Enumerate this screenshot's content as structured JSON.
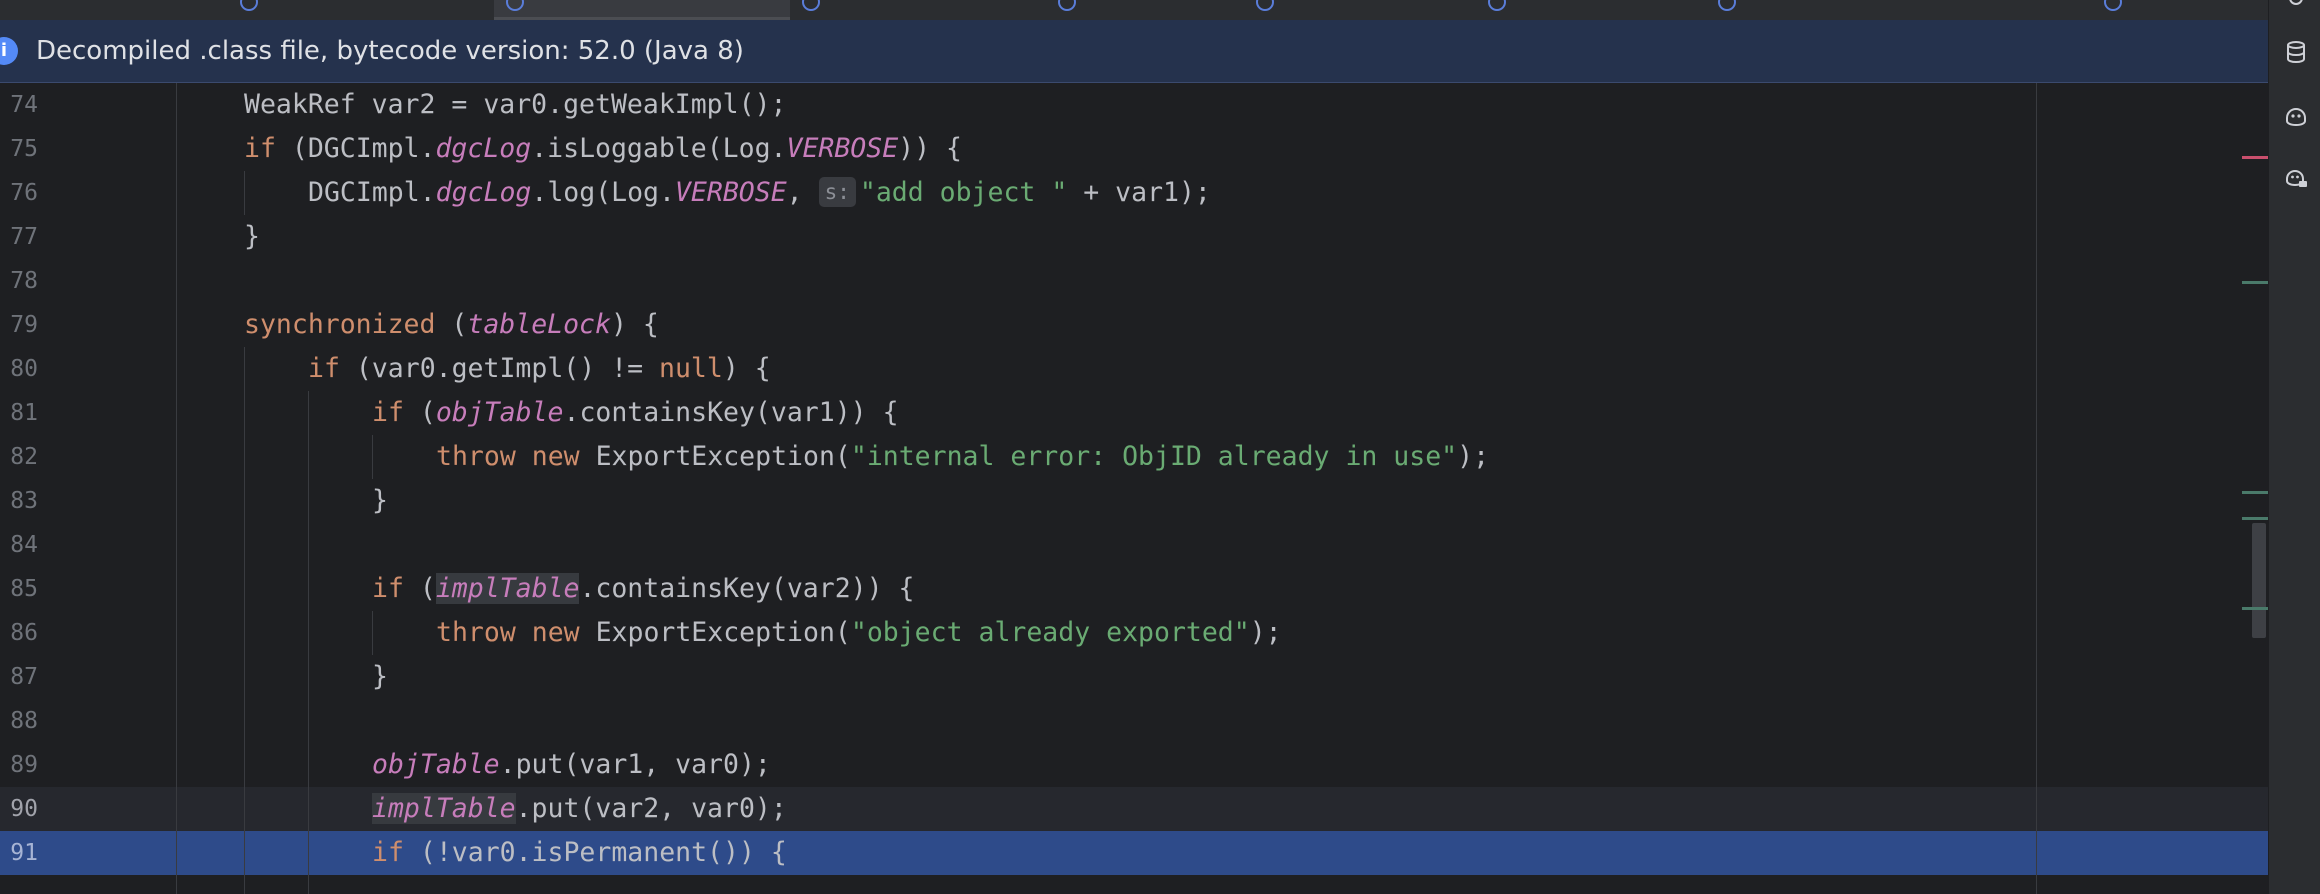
{
  "banner": {
    "icon": "info-icon",
    "text": "Decompiled .class file, bytecode version: 52.0 (Java 8)"
  },
  "tabs": [
    {
      "name": "tab-1",
      "active": false
    },
    {
      "name": "tab-2",
      "active": false
    },
    {
      "name": "tab-3",
      "active": true
    },
    {
      "name": "tab-4",
      "active": false
    },
    {
      "name": "tab-5",
      "active": false
    },
    {
      "name": "tab-6",
      "active": false
    },
    {
      "name": "tab-7",
      "active": false
    },
    {
      "name": "tab-8",
      "active": false
    },
    {
      "name": "tab-9",
      "active": false
    }
  ],
  "editor": {
    "caret_line": "90",
    "selected_line": "91",
    "lines": [
      {
        "num": "74",
        "t1": "WeakRef var2 = var0.getWeakImpl();"
      },
      {
        "num": "75",
        "kw1": "if",
        "t1": " (DGCImpl.",
        "f1": "dgcLog",
        "t2": ".isLoggable(Log.",
        "f2": "VERBOSE",
        "t3": ")) {"
      },
      {
        "num": "76",
        "t1": "DGCImpl.",
        "f1": "dgcLog",
        "t2": ".log(Log.",
        "f2": "VERBOSE",
        "t3": ", ",
        "hint": "s:",
        "s1": "\"add object \"",
        "t4": " + var1);"
      },
      {
        "num": "77",
        "t1": "}"
      },
      {
        "num": "78"
      },
      {
        "num": "79",
        "kw1": "synchronized",
        "t1": " (",
        "f1": "tableLock",
        "t2": ") {"
      },
      {
        "num": "80",
        "kw1": "if",
        "t1": " (var0.getImpl() != ",
        "kw2": "null",
        "t2": ") {"
      },
      {
        "num": "81",
        "kw1": "if",
        "t1": " (",
        "f1": "objTable",
        "t2": ".containsKey(var1)) {"
      },
      {
        "num": "82",
        "kw1": "throw",
        "kw2": "new",
        "t1": " ExportException(",
        "s1": "\"internal error: ObjID already in use\"",
        "t2": ");"
      },
      {
        "num": "83",
        "t1": "}"
      },
      {
        "num": "84"
      },
      {
        "num": "85",
        "kw1": "if",
        "t1": " (",
        "f1": "implTable",
        "t2": ".containsKey(var2)) {"
      },
      {
        "num": "86",
        "kw1": "throw",
        "kw2": "new",
        "t1": " ExportException(",
        "s1": "\"object already exported\"",
        "t2": ");"
      },
      {
        "num": "87",
        "t1": "}"
      },
      {
        "num": "88"
      },
      {
        "num": "89",
        "f1": "objTable",
        "t1": ".put(var1, var0);"
      },
      {
        "num": "90",
        "f1": "implTable",
        "t1": ".put(var2, var0);"
      },
      {
        "num": "91",
        "kw1": "if",
        "t1": " (!var0.isPermanent()) {"
      }
    ]
  },
  "markers": {
    "error_color": "#c94f6d",
    "change_color": "#4a7a6a"
  },
  "toolbar": {
    "icons": [
      "database-icon",
      "copilot-icon",
      "copilot-chat-icon"
    ]
  },
  "colors": {
    "keyword": "#cf8e6d",
    "field": "#c77dbb",
    "string": "#6aab73",
    "selection": "#2e4b8a"
  }
}
